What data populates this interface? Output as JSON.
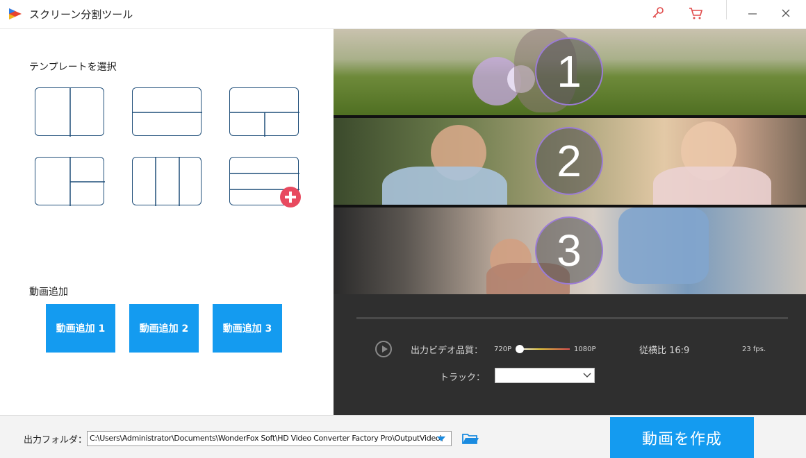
{
  "app": {
    "title": "スクリーン分割ツール"
  },
  "left": {
    "template_heading": "テンプレートを選択",
    "add_heading": "動画追加",
    "add_buttons": [
      "動画追加 1",
      "動画追加 2",
      "動画追加 3"
    ]
  },
  "preview": {
    "segments": [
      "1",
      "2",
      "3"
    ]
  },
  "controls": {
    "quality_label": "出力ビデオ品質：",
    "quality_min": "720P",
    "quality_max": "1080P",
    "quality_value": 0,
    "aspect_ratio": "従横比 16:9",
    "fps": "23 fps.",
    "track_label": "トラック：",
    "track_value": ""
  },
  "bottom": {
    "output_label": "出力フォルダ：",
    "output_path": "C:\\Users\\Administrator\\Documents\\WonderFox Soft\\HD Video Converter Factory Pro\\OutputVideo\\",
    "create_button": "動画を作成"
  },
  "colors": {
    "accent": "#149bf0",
    "template_border": "#1f4e79",
    "badge_red": "#e84a5f",
    "dark_panel": "#2f2f2f"
  },
  "icons": [
    "app-logo-icon",
    "key-icon",
    "cart-icon",
    "minimize-icon",
    "close-icon",
    "play-icon",
    "chevron-down-icon",
    "folder-icon",
    "add-template-icon"
  ]
}
